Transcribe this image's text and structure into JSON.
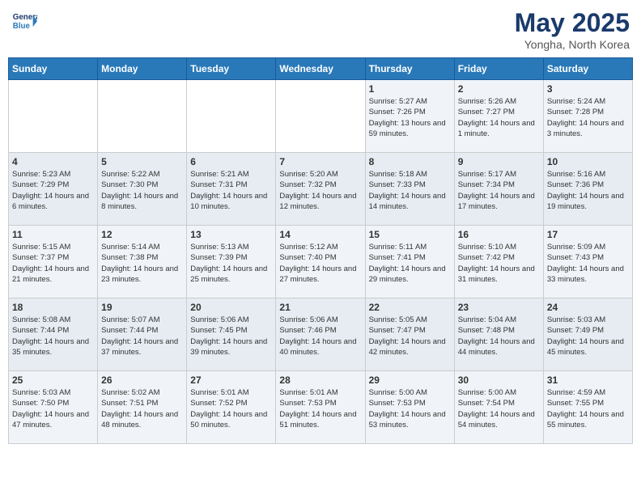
{
  "header": {
    "logo_line1": "General",
    "logo_line2": "Blue",
    "title": "May 2025",
    "subtitle": "Yongha, North Korea"
  },
  "days_of_week": [
    "Sunday",
    "Monday",
    "Tuesday",
    "Wednesday",
    "Thursday",
    "Friday",
    "Saturday"
  ],
  "weeks": [
    [
      {
        "day": "",
        "info": ""
      },
      {
        "day": "",
        "info": ""
      },
      {
        "day": "",
        "info": ""
      },
      {
        "day": "",
        "info": ""
      },
      {
        "day": "1",
        "info": "Sunrise: 5:27 AM\nSunset: 7:26 PM\nDaylight: 13 hours and 59 minutes."
      },
      {
        "day": "2",
        "info": "Sunrise: 5:26 AM\nSunset: 7:27 PM\nDaylight: 14 hours and 1 minute."
      },
      {
        "day": "3",
        "info": "Sunrise: 5:24 AM\nSunset: 7:28 PM\nDaylight: 14 hours and 3 minutes."
      }
    ],
    [
      {
        "day": "4",
        "info": "Sunrise: 5:23 AM\nSunset: 7:29 PM\nDaylight: 14 hours and 6 minutes."
      },
      {
        "day": "5",
        "info": "Sunrise: 5:22 AM\nSunset: 7:30 PM\nDaylight: 14 hours and 8 minutes."
      },
      {
        "day": "6",
        "info": "Sunrise: 5:21 AM\nSunset: 7:31 PM\nDaylight: 14 hours and 10 minutes."
      },
      {
        "day": "7",
        "info": "Sunrise: 5:20 AM\nSunset: 7:32 PM\nDaylight: 14 hours and 12 minutes."
      },
      {
        "day": "8",
        "info": "Sunrise: 5:18 AM\nSunset: 7:33 PM\nDaylight: 14 hours and 14 minutes."
      },
      {
        "day": "9",
        "info": "Sunrise: 5:17 AM\nSunset: 7:34 PM\nDaylight: 14 hours and 17 minutes."
      },
      {
        "day": "10",
        "info": "Sunrise: 5:16 AM\nSunset: 7:36 PM\nDaylight: 14 hours and 19 minutes."
      }
    ],
    [
      {
        "day": "11",
        "info": "Sunrise: 5:15 AM\nSunset: 7:37 PM\nDaylight: 14 hours and 21 minutes."
      },
      {
        "day": "12",
        "info": "Sunrise: 5:14 AM\nSunset: 7:38 PM\nDaylight: 14 hours and 23 minutes."
      },
      {
        "day": "13",
        "info": "Sunrise: 5:13 AM\nSunset: 7:39 PM\nDaylight: 14 hours and 25 minutes."
      },
      {
        "day": "14",
        "info": "Sunrise: 5:12 AM\nSunset: 7:40 PM\nDaylight: 14 hours and 27 minutes."
      },
      {
        "day": "15",
        "info": "Sunrise: 5:11 AM\nSunset: 7:41 PM\nDaylight: 14 hours and 29 minutes."
      },
      {
        "day": "16",
        "info": "Sunrise: 5:10 AM\nSunset: 7:42 PM\nDaylight: 14 hours and 31 minutes."
      },
      {
        "day": "17",
        "info": "Sunrise: 5:09 AM\nSunset: 7:43 PM\nDaylight: 14 hours and 33 minutes."
      }
    ],
    [
      {
        "day": "18",
        "info": "Sunrise: 5:08 AM\nSunset: 7:44 PM\nDaylight: 14 hours and 35 minutes."
      },
      {
        "day": "19",
        "info": "Sunrise: 5:07 AM\nSunset: 7:44 PM\nDaylight: 14 hours and 37 minutes."
      },
      {
        "day": "20",
        "info": "Sunrise: 5:06 AM\nSunset: 7:45 PM\nDaylight: 14 hours and 39 minutes."
      },
      {
        "day": "21",
        "info": "Sunrise: 5:06 AM\nSunset: 7:46 PM\nDaylight: 14 hours and 40 minutes."
      },
      {
        "day": "22",
        "info": "Sunrise: 5:05 AM\nSunset: 7:47 PM\nDaylight: 14 hours and 42 minutes."
      },
      {
        "day": "23",
        "info": "Sunrise: 5:04 AM\nSunset: 7:48 PM\nDaylight: 14 hours and 44 minutes."
      },
      {
        "day": "24",
        "info": "Sunrise: 5:03 AM\nSunset: 7:49 PM\nDaylight: 14 hours and 45 minutes."
      }
    ],
    [
      {
        "day": "25",
        "info": "Sunrise: 5:03 AM\nSunset: 7:50 PM\nDaylight: 14 hours and 47 minutes."
      },
      {
        "day": "26",
        "info": "Sunrise: 5:02 AM\nSunset: 7:51 PM\nDaylight: 14 hours and 48 minutes."
      },
      {
        "day": "27",
        "info": "Sunrise: 5:01 AM\nSunset: 7:52 PM\nDaylight: 14 hours and 50 minutes."
      },
      {
        "day": "28",
        "info": "Sunrise: 5:01 AM\nSunset: 7:53 PM\nDaylight: 14 hours and 51 minutes."
      },
      {
        "day": "29",
        "info": "Sunrise: 5:00 AM\nSunset: 7:53 PM\nDaylight: 14 hours and 53 minutes."
      },
      {
        "day": "30",
        "info": "Sunrise: 5:00 AM\nSunset: 7:54 PM\nDaylight: 14 hours and 54 minutes."
      },
      {
        "day": "31",
        "info": "Sunrise: 4:59 AM\nSunset: 7:55 PM\nDaylight: 14 hours and 55 minutes."
      }
    ]
  ]
}
